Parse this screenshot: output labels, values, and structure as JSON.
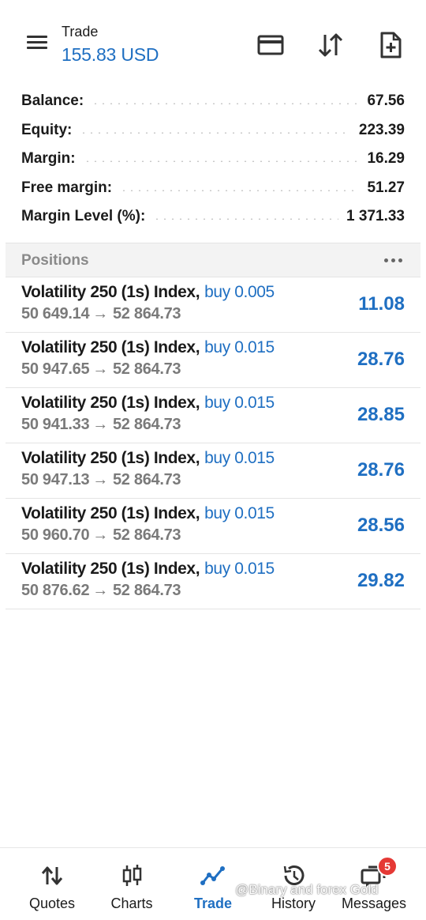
{
  "header": {
    "title": "Trade",
    "subtitle": "155.83 USD",
    "icons": [
      "card-icon",
      "sort-icon",
      "new-order-icon"
    ]
  },
  "summary": [
    {
      "label": "Balance:",
      "value": "67.56"
    },
    {
      "label": "Equity:",
      "value": "223.39"
    },
    {
      "label": "Margin:",
      "value": "16.29"
    },
    {
      "label": "Free margin:",
      "value": "51.27"
    },
    {
      "label": "Margin Level (%):",
      "value": "1 371.33"
    }
  ],
  "positions_header": {
    "title": "Positions",
    "more_icon": "more-horizontal-icon"
  },
  "positions": [
    {
      "symbol": "Volatility 250 (1s) Index,",
      "side": "buy 0.005",
      "open": "50 649.14",
      "arrow": "→",
      "current": "52 864.73",
      "profit": "11.08"
    },
    {
      "symbol": "Volatility 250 (1s) Index,",
      "side": "buy 0.015",
      "open": "50 947.65",
      "arrow": "→",
      "current": "52 864.73",
      "profit": "28.76"
    },
    {
      "symbol": "Volatility 250 (1s) Index,",
      "side": "buy 0.015",
      "open": "50 941.33",
      "arrow": "→",
      "current": "52 864.73",
      "profit": "28.85"
    },
    {
      "symbol": "Volatility 250 (1s) Index,",
      "side": "buy 0.015",
      "open": "50 947.13",
      "arrow": "→",
      "current": "52 864.73",
      "profit": "28.76"
    },
    {
      "symbol": "Volatility 250 (1s) Index,",
      "side": "buy 0.015",
      "open": "50 960.70",
      "arrow": "→",
      "current": "52 864.73",
      "profit": "28.56"
    },
    {
      "symbol": "Volatility 250 (1s) Index,",
      "side": "buy 0.015",
      "open": "50 876.62",
      "arrow": "→",
      "current": "52 864.73",
      "profit": "29.82"
    }
  ],
  "nav": [
    {
      "label": "Quotes",
      "icon": "quotes-icon"
    },
    {
      "label": "Charts",
      "icon": "candlestick-icon"
    },
    {
      "label": "Trade",
      "icon": "trade-icon",
      "active": true
    },
    {
      "label": "History",
      "icon": "history-icon"
    },
    {
      "label": "Messages",
      "icon": "messages-icon",
      "badge": "5"
    }
  ],
  "watermark": "@Binary and forex Gold",
  "colors": {
    "accent": "#1f6fc2",
    "badge": "#e53935",
    "muted": "#7a7a7a"
  }
}
